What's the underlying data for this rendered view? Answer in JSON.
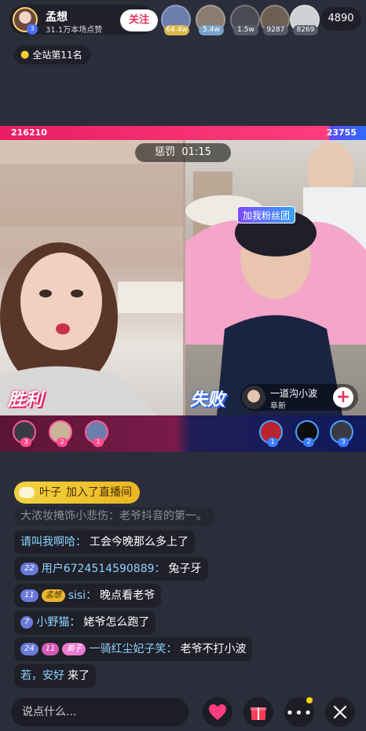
{
  "host": {
    "name": "孟想",
    "likes": "31.1万本场点赞",
    "level": "3",
    "follow_label": "关注"
  },
  "top_viewers": [
    {
      "badge": "64.4w",
      "badge_color": "#d9b84a",
      "color": "#6b7fae"
    },
    {
      "badge": "5.4w",
      "badge_color": "#7aa3c9",
      "color": "#8a7d70"
    },
    {
      "badge": "1.5w",
      "badge_color": "#555a66",
      "color": "#4a4a52"
    },
    {
      "badge": "9287",
      "badge_color": "#555a66",
      "color": "#6d6055"
    },
    {
      "badge": "8269",
      "badge_color": "#555a66",
      "color": "#cfcfd4"
    }
  ],
  "viewer_count": "4890",
  "rank": {
    "icon": "flame-icon",
    "label": "全站第11名"
  },
  "score": {
    "left": "216210",
    "right": "23755",
    "left_share": 0.9
  },
  "pk": {
    "timer_label": "惩罚",
    "timer": "01:15",
    "left_stamp": "胜利",
    "right_stamp": "失败",
    "fan_banner": "加我粉丝团",
    "opponent": {
      "name": "一道沟小波",
      "location": "阜新",
      "add_label": "+"
    }
  },
  "contributors": {
    "left": [
      {
        "num": "3",
        "color": "#3a3a44"
      },
      {
        "num": "2",
        "color": "#c9b49a"
      },
      {
        "num": "1",
        "color": "#6b7fae"
      }
    ],
    "right": [
      {
        "num": "1",
        "color": "#b8232f"
      },
      {
        "num": "2",
        "color": "#0d0d10"
      },
      {
        "num": "3",
        "color": "#3a3a44"
      }
    ]
  },
  "chat": {
    "join": {
      "user": "叶子",
      "text": "加入了直播间"
    },
    "messages": [
      {
        "text": "大浓妆掩饰小悲伤：老爷抖音的第一。",
        "faded": true
      },
      {
        "user": "请叫我啊哈：",
        "text": "工会今晚那么多上了"
      },
      {
        "level": "22",
        "user": "用户6724514590889：",
        "text": "兔子牙"
      },
      {
        "level": "11",
        "fan": "孟想",
        "user": "sisi：",
        "text": "晚点看老爷"
      },
      {
        "level": "7",
        "user": "小野猫：",
        "text": "姥爷怎么跑了"
      },
      {
        "level": "24",
        "fan": "弟子",
        "fan_level": "11",
        "user": "一骑红尘妃子笑：",
        "text": "老爷不打小波"
      },
      {
        "user": "若，安好",
        "text": "来了"
      }
    ]
  },
  "bottom": {
    "placeholder": "说点什么...",
    "like_icon": "heart-icon",
    "gift_icon": "gift-icon",
    "more_icon": "more-icon",
    "close_icon": "close-icon"
  }
}
